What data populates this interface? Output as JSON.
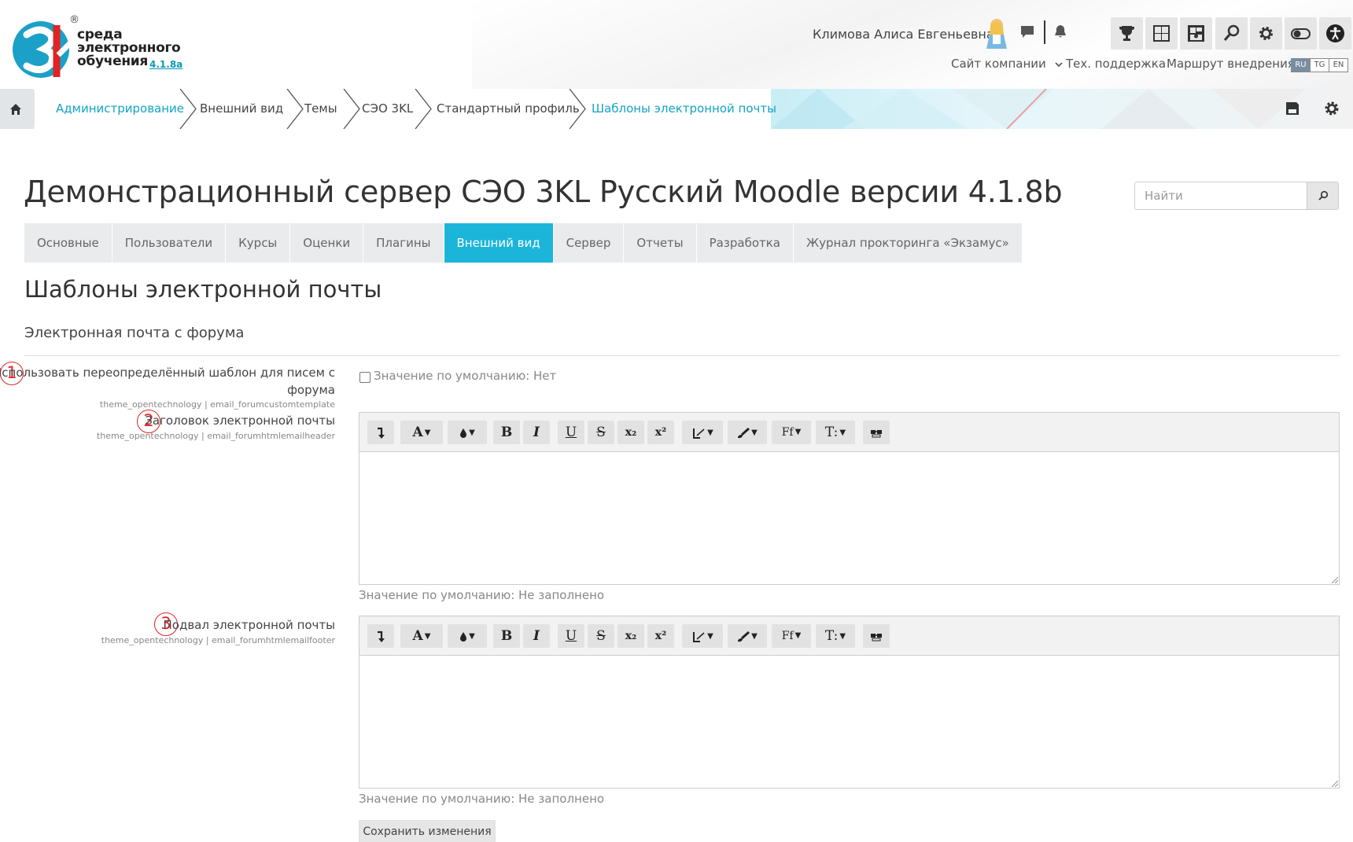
{
  "logo": {
    "reg_mark": "®",
    "line1": "среда",
    "line2": "электронного",
    "line3": "обучения",
    "version": "4.1.8a"
  },
  "header": {
    "user_name": "Климова Алиса Евгеньевна",
    "links": {
      "company_site": "Сайт компании",
      "support": "Тех. поддержка",
      "route": "Маршрут внедрения"
    },
    "languages": [
      "RU",
      "TG",
      "EN"
    ],
    "active_language": "RU"
  },
  "breadcrumb": {
    "items": [
      "Администрирование",
      "Внешний вид",
      "Темы",
      "СЭО 3KL",
      "Стандартный профиль",
      "Шаблоны электронной почты"
    ]
  },
  "page": {
    "title": "Демонстрационный сервер СЭО 3KL Русский Moodle версии 4.1.8b",
    "search_placeholder": "Найти"
  },
  "tabs": [
    "Основные",
    "Пользователи",
    "Курсы",
    "Оценки",
    "Плагины",
    "Внешний вид",
    "Сервер",
    "Отчеты",
    "Разработка",
    "Журнал прокторинга «Экзамус»"
  ],
  "active_tab": "Внешний вид",
  "section": {
    "title": "Шаблоны электронной почты",
    "subtitle": "Электронная почта с форума"
  },
  "settings": {
    "custom_template": {
      "marker": "1",
      "label_line1": "Использовать переопределённый шаблон для писем с",
      "label_line2": "форума",
      "key": "theme_opentechnology | email_forumcustomtemplate",
      "default_note": "Значение по умолчанию: Нет",
      "checked": false
    },
    "email_header": {
      "marker": "2",
      "label": "Заголовок электронной почты",
      "key": "theme_opentechnology | email_forumhtmlemailheader",
      "default_note": "Значение по умолчанию: Не заполнено",
      "value": ""
    },
    "email_footer": {
      "marker": "3",
      "label": "Подвал электронной почты",
      "key": "theme_opentechnology | email_forumhtmlemailfooter",
      "default_note": "Значение по умолчанию: Не заполнено",
      "value": ""
    }
  },
  "toolbar_glyphs": {
    "font_color": "A",
    "bold": "B",
    "italic": "I",
    "underline": "U",
    "strike": "S",
    "subscript": "x₂",
    "superscript": "x²",
    "font_family": "Ff",
    "font_size": "T:"
  },
  "save_button": "Сохранить изменения",
  "colors": {
    "accent": "#1cb5da",
    "link": "#14a3c7",
    "marker": "#e02424"
  }
}
